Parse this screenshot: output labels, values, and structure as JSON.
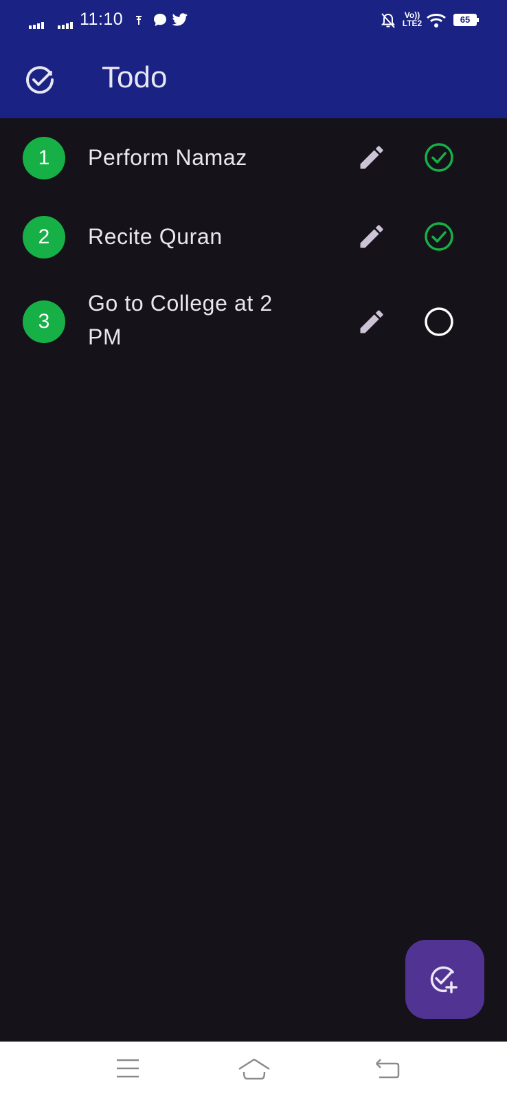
{
  "status_bar": {
    "time": "11:10",
    "network_label": "Vo)) LTE2",
    "battery_level": "65"
  },
  "app_bar": {
    "title": "Todo",
    "icon": "check-circle-icon",
    "color": "#1a2384"
  },
  "todos": [
    {
      "number": "1",
      "text": "Perform Namaz",
      "completed": true
    },
    {
      "number": "2",
      "text": "Recite Quran",
      "completed": true
    },
    {
      "number": "3",
      "text": "Go to College at 2 PM",
      "completed": false
    }
  ],
  "colors": {
    "background": "#151219",
    "badge": "#16b046",
    "fab": "#513394",
    "edit_icon": "#cdc3d6"
  },
  "fab": {
    "icon": "add-task-icon"
  },
  "nav_bar": {
    "icons": [
      "menu-icon",
      "home-icon",
      "back-icon"
    ]
  }
}
